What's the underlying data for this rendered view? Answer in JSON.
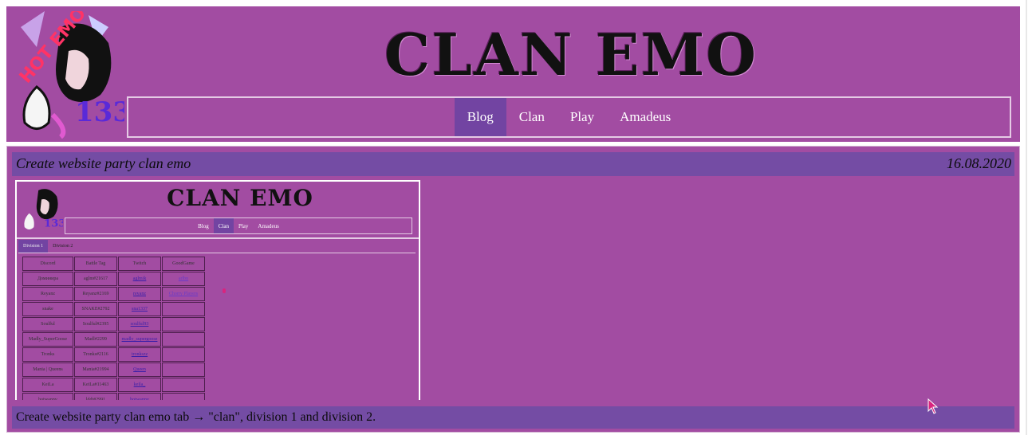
{
  "header": {
    "site_title": "CLAN EMO",
    "logo_text": "HOT EMO 1337",
    "nav": [
      "Blog",
      "Clan",
      "Play",
      "Amadeus"
    ],
    "active_nav": "Blog"
  },
  "post": {
    "title": "Create website party clan emo",
    "date": "16.08.2020",
    "caption": "Create website party clan emo tab → \"clan\", division 1 and division 2."
  },
  "screenshot": {
    "title": "CLAN EMO",
    "nav": [
      "Blog",
      "Clan",
      "Play",
      "Amadeus"
    ],
    "tabs": [
      "Division 1",
      "Division 2"
    ],
    "columns": [
      "Discord",
      "Battle Tag",
      "Twitch",
      "GoodGame"
    ],
    "rows": [
      [
        "Доминира",
        "aglm#21617",
        "aglmik",
        "arlbn"
      ],
      [
        "Reyanz",
        "Reyanz#2169",
        "reyanz",
        "Chorry Players"
      ],
      [
        "snake",
        "SNAKE#2792",
        "sna1337",
        ""
      ],
      [
        "Soulful",
        "Soulful#2395",
        "soulful93",
        ""
      ],
      [
        "Madly_SuperGoose",
        "Madl#2299",
        "madly_supergoose",
        ""
      ],
      [
        "Tronks",
        "Tronks#2116",
        "tronkszz",
        ""
      ],
      [
        "Mania | Queens",
        "Mania#21994",
        "Queen",
        ""
      ],
      [
        "KeiLa",
        "KeiLa#11463",
        "keila_",
        ""
      ],
      [
        "hotwanny",
        "lddt#2991",
        "hotwanny",
        ""
      ],
      [
        "Edek",
        "Edek#1850",
        "",
        ""
      ]
    ]
  }
}
